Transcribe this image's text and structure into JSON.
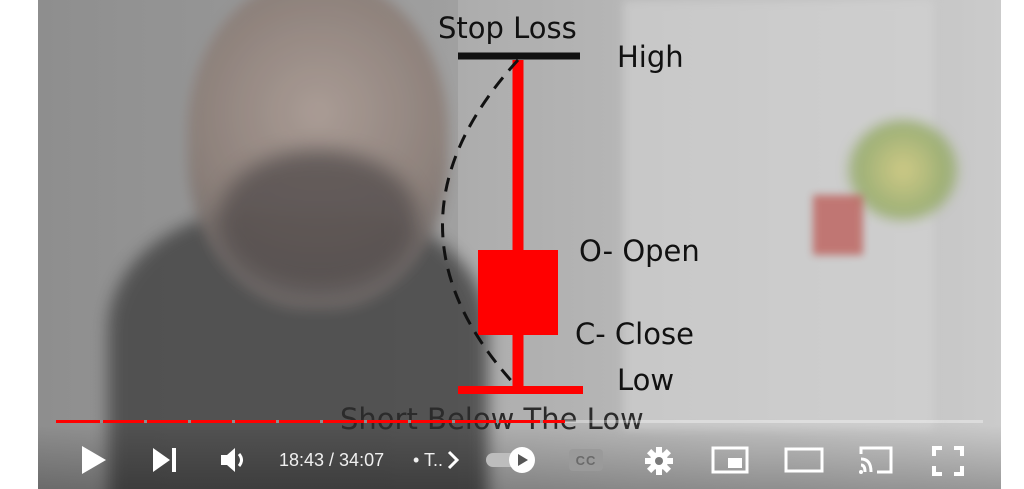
{
  "overlay": {
    "stop_loss": "Stop Loss",
    "high": "High",
    "open": "O- Open",
    "close": "C- Close",
    "low": "Low",
    "short_below": "Short Below The Low",
    "candle_color": "#ff0000"
  },
  "player": {
    "current_time": "18:43",
    "separator": " / ",
    "duration": "34:07",
    "time_display": "18:43 / 34:07",
    "chapter_text": "• T..",
    "progress_fraction": 0.5486,
    "icons": {
      "play": "play-icon",
      "next": "next-icon",
      "volume": "volume-icon",
      "chapter_chevron": "chevron-right-icon",
      "autoplay": "autoplay-toggle-icon",
      "captions": "closed-captions-icon",
      "settings": "gear-icon",
      "miniplayer": "miniplayer-icon",
      "theater": "theater-mode-icon",
      "cast": "cast-icon",
      "fullscreen": "fullscreen-icon"
    },
    "captions_label": "CC"
  }
}
